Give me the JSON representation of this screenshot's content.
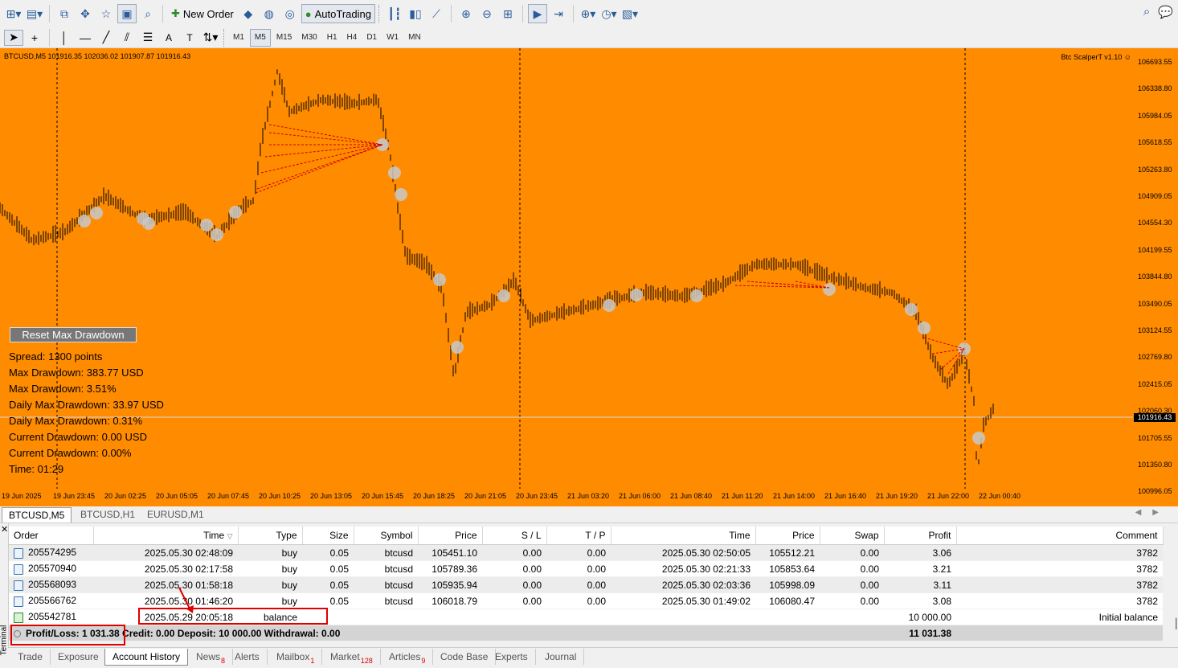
{
  "toolbar": {
    "new_order_label": "New Order",
    "autotrading_label": "AutoTrading",
    "timeframes": [
      "M1",
      "M5",
      "M15",
      "M30",
      "H1",
      "H4",
      "D1",
      "W1",
      "MN"
    ],
    "active_timeframe": "M5"
  },
  "chart": {
    "title": "BTCUSD,M5  101916.35 102036.02 101907.87 101916.43",
    "ea_label": "Btc ScalperT v1.10 ☺",
    "background": "#ff8c00",
    "price_ticks": [
      "106693.55",
      "106338.80",
      "105984.05",
      "105618.55",
      "105263.80",
      "104909.05",
      "104554.30",
      "104199.55",
      "103844.80",
      "103490.05",
      "103124.55",
      "102769.80",
      "102415.05",
      "102060.30",
      "101705.55",
      "101350.80",
      "100996.05"
    ],
    "current_price": "101916.43",
    "time_ticks": [
      "19 Jun 2025",
      "19 Jun 23:45",
      "20 Jun 02:25",
      "20 Jun 05:05",
      "20 Jun 07:45",
      "20 Jun 10:25",
      "20 Jun 13:05",
      "20 Jun 15:45",
      "20 Jun 18:25",
      "20 Jun 21:05",
      "20 Jun 23:45",
      "21 Jun 03:20",
      "21 Jun 06:00",
      "21 Jun 08:40",
      "21 Jun 11:20",
      "21 Jun 14:00",
      "21 Jun 16:40",
      "21 Jun 19:20",
      "21 Jun 22:00",
      "22 Jun 00:40"
    ],
    "reset_button_label": "Reset Max Drawdown",
    "info_lines": [
      "Spread: 1300 points",
      "Max Drawdown: 383.77 USD",
      "Max Drawdown: 3.51%",
      "Daily Max Drawdown: 33.97 USD",
      "Daily Max Drawdown: 0.31%",
      "Current Drawdown: 0.00 USD",
      "Current Drawdown: 0.00%",
      "Time: 01:29"
    ]
  },
  "chart_tabs": [
    "BTCUSD,M5",
    "BTCUSD,H1",
    "EURUSD,M1"
  ],
  "terminal": {
    "side_label": "Terminal",
    "columns": [
      "Order",
      "Time",
      "Type",
      "Size",
      "Symbol",
      "Price",
      "S / L",
      "T / P",
      "Time",
      "Price",
      "Swap",
      "Profit",
      "Comment"
    ],
    "rows": [
      {
        "order": "205574295",
        "open_time": "2025.05.30 02:48:09",
        "type": "buy",
        "size": "0.05",
        "symbol": "btcusd",
        "price": "105451.10",
        "sl": "0.00",
        "tp": "0.00",
        "close_time": "2025.05.30 02:50:05",
        "close_price": "105512.21",
        "swap": "0.00",
        "profit": "3.06",
        "comment": "3782"
      },
      {
        "order": "205570940",
        "open_time": "2025.05.30 02:17:58",
        "type": "buy",
        "size": "0.05",
        "symbol": "btcusd",
        "price": "105789.36",
        "sl": "0.00",
        "tp": "0.00",
        "close_time": "2025.05.30 02:21:33",
        "close_price": "105853.64",
        "swap": "0.00",
        "profit": "3.21",
        "comment": "3782"
      },
      {
        "order": "205568093",
        "open_time": "2025.05.30 01:58:18",
        "type": "buy",
        "size": "0.05",
        "symbol": "btcusd",
        "price": "105935.94",
        "sl": "0.00",
        "tp": "0.00",
        "close_time": "2025.05.30 02:03:36",
        "close_price": "105998.09",
        "swap": "0.00",
        "profit": "3.11",
        "comment": "3782"
      },
      {
        "order": "205566762",
        "open_time": "2025.05.30 01:46:20",
        "type": "buy",
        "size": "0.05",
        "symbol": "btcusd",
        "price": "106018.79",
        "sl": "0.00",
        "tp": "0.00",
        "close_time": "2025.05.30 01:49:02",
        "close_price": "106080.47",
        "swap": "0.00",
        "profit": "3.08",
        "comment": "3782"
      }
    ],
    "balance_row": {
      "order": "205542781",
      "time": "2025.05.29 20:05:18",
      "type": "balance",
      "profit": "10 000.00",
      "comment": "Initial balance"
    },
    "summary": {
      "text": "Profit/Loss: 1 031.38  Credit: 0.00  Deposit: 10 000.00  Withdrawal: 0.00",
      "total": "11 031.38"
    }
  },
  "bottom_tabs": [
    {
      "label": "Trade",
      "badge": ""
    },
    {
      "label": "Exposure",
      "badge": ""
    },
    {
      "label": "Account History",
      "badge": ""
    },
    {
      "label": "News",
      "badge": "8"
    },
    {
      "label": "Alerts",
      "badge": ""
    },
    {
      "label": "Mailbox",
      "badge": "1"
    },
    {
      "label": "Market",
      "badge": "128"
    },
    {
      "label": "Articles",
      "badge": "9"
    },
    {
      "label": "Code Base",
      "badge": ""
    },
    {
      "label": "Experts",
      "badge": ""
    },
    {
      "label": "Journal",
      "badge": ""
    }
  ],
  "active_bottom_tab": "Account History",
  "annotation_color": "#e00000"
}
